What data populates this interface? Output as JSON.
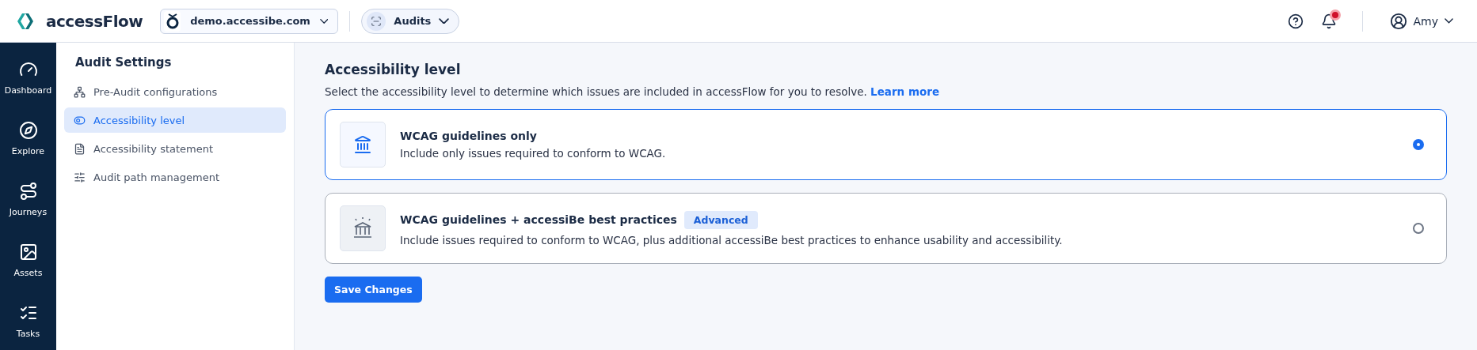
{
  "header": {
    "brand": "accessFlow",
    "site": "demo.accessibe.com",
    "section": "Audits",
    "user": "Amy",
    "notification_dot": true
  },
  "nav": [
    {
      "label": "Dashboard",
      "selected": false
    },
    {
      "label": "Explore",
      "selected": false
    },
    {
      "label": "Journeys",
      "selected": false
    },
    {
      "label": "Assets",
      "selected": false
    },
    {
      "label": "Tasks",
      "selected": false
    }
  ],
  "settings": {
    "title": "Audit Settings",
    "items": [
      {
        "label": "Pre-Audit configurations",
        "selected": false
      },
      {
        "label": "Accessibility level",
        "selected": true
      },
      {
        "label": "Accessibility statement",
        "selected": false
      },
      {
        "label": "Audit path management",
        "selected": false
      }
    ]
  },
  "content": {
    "title": "Accessibility level",
    "description": "Select the accessibility level to determine which issues are included in accessFlow for you to resolve.",
    "link": "Learn more",
    "options": [
      {
        "title": "WCAG guidelines only",
        "description": "Include only issues required to conform to WCAG.",
        "selected": true
      },
      {
        "title": "WCAG guidelines + accessiBe best practices",
        "badge": "Advanced",
        "description": "Include issues required to conform to WCAG, plus additional accessiBe best practices to enhance usability and accessibility.",
        "selected": false
      }
    ],
    "save_button": "Save Changes"
  }
}
